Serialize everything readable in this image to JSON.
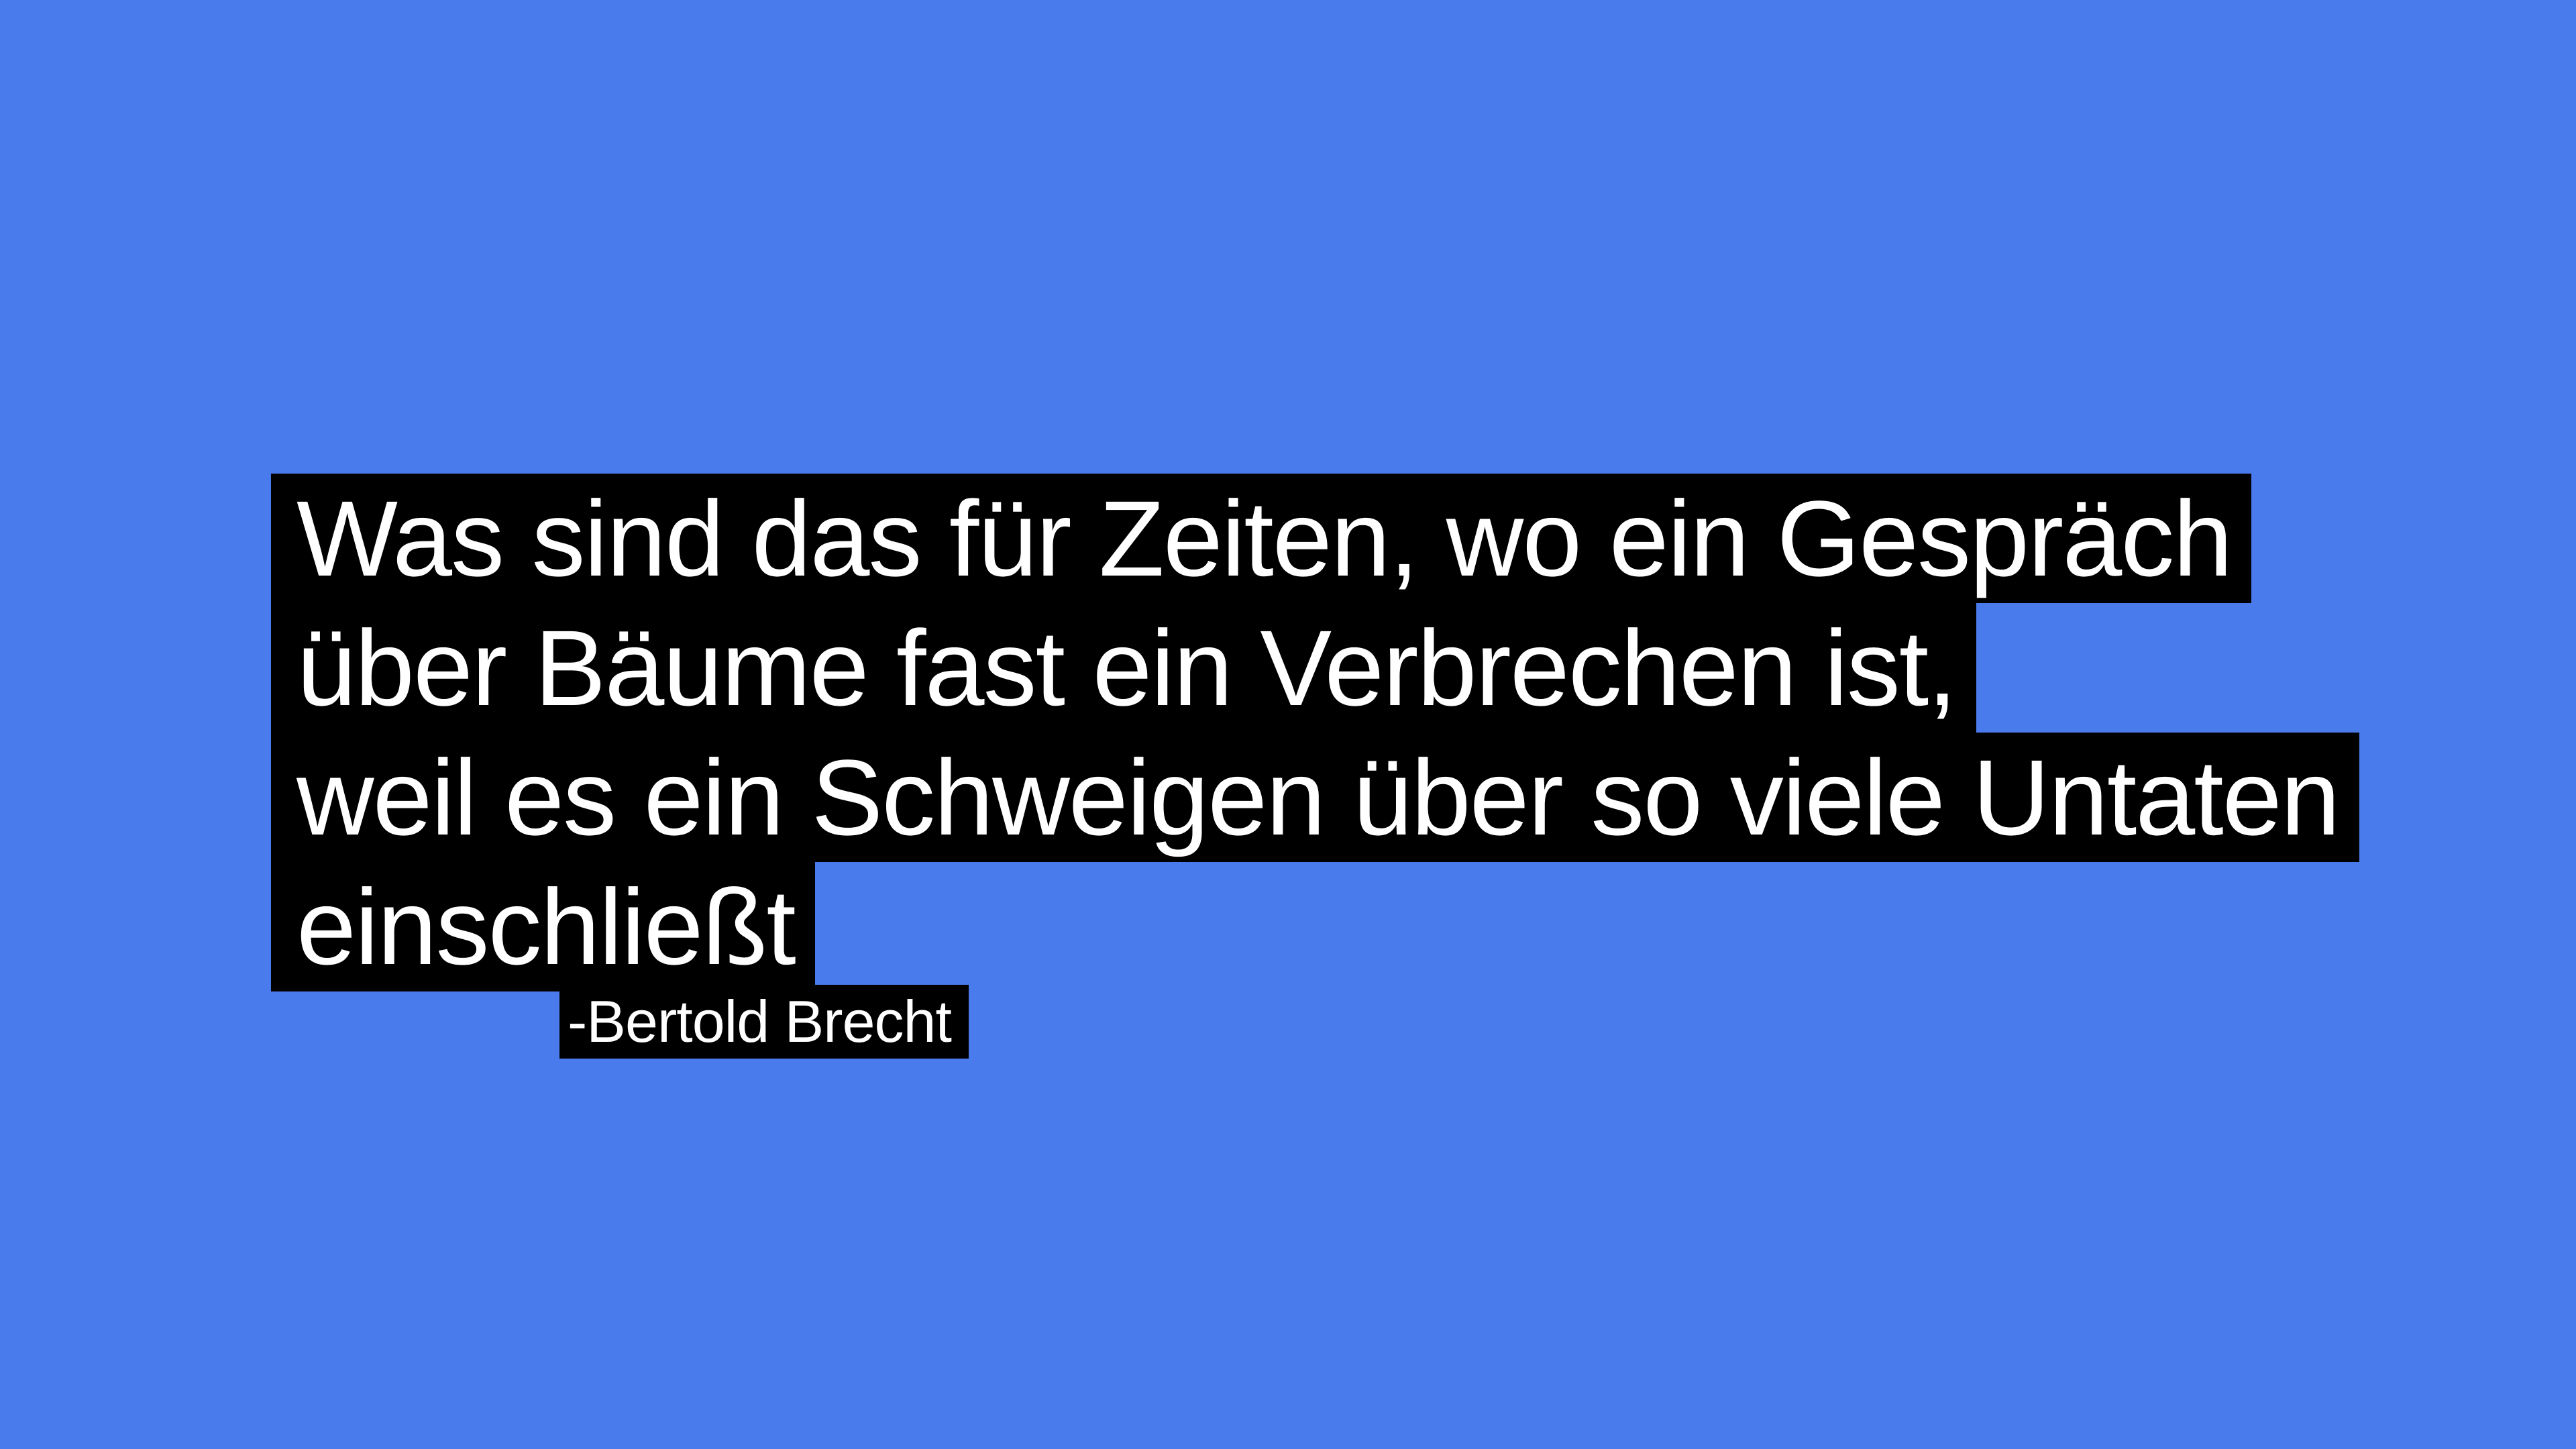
{
  "background_color": "#4a7bec",
  "highlight_color": "#000000",
  "text_color": "#ffffff",
  "quote": {
    "lines": [
      "Was sind das für Zeiten, wo ein Gespräch",
      "über Bäume fast ein Verbrechen ist,",
      "weil es ein Schweigen über so viele Untaten",
      "einschließt"
    ]
  },
  "attribution": "-Bertold Brecht"
}
